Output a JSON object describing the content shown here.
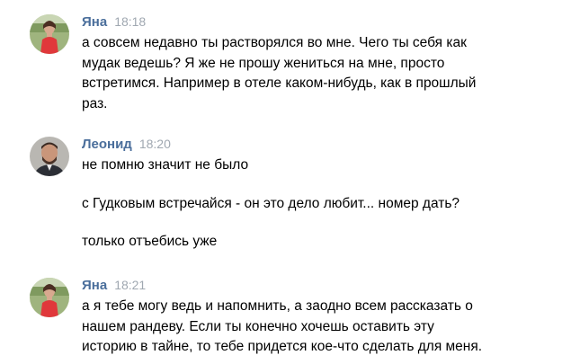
{
  "messages": [
    {
      "author": "Яна",
      "time": "18:18",
      "lines": [
        "а совсем недавно ты растворялся во мне. Чего ты себя как",
        "мудак ведешь? Я же не прошу жениться на мне, просто",
        "встретимся. Например в отеле каком-нибудь, как в прошлый",
        "раз."
      ]
    },
    {
      "author": "Леонид",
      "time": "18:20",
      "paragraphs": [
        "не помню значит не было",
        "с Гудковым встречайся - он это дело любит... номер дать?",
        "только отъебись уже"
      ]
    },
    {
      "author": "Яна",
      "time": "18:21",
      "lines": [
        "а я тебе могу ведь и напомнить, а заодно всем рассказать о",
        "нашем рандеву. Если ты конечно хочешь оставить эту",
        "историю в тайне, то тебе придется кое-что сделать для меня."
      ]
    }
  ],
  "colors": {
    "author": "#4a6e9b",
    "time": "#a0a8b1",
    "text": "#000000",
    "background": "#ffffff"
  },
  "icons": {
    "avatar_yana": "avatar-yana-photo",
    "avatar_leonid": "avatar-leonid-photo"
  }
}
